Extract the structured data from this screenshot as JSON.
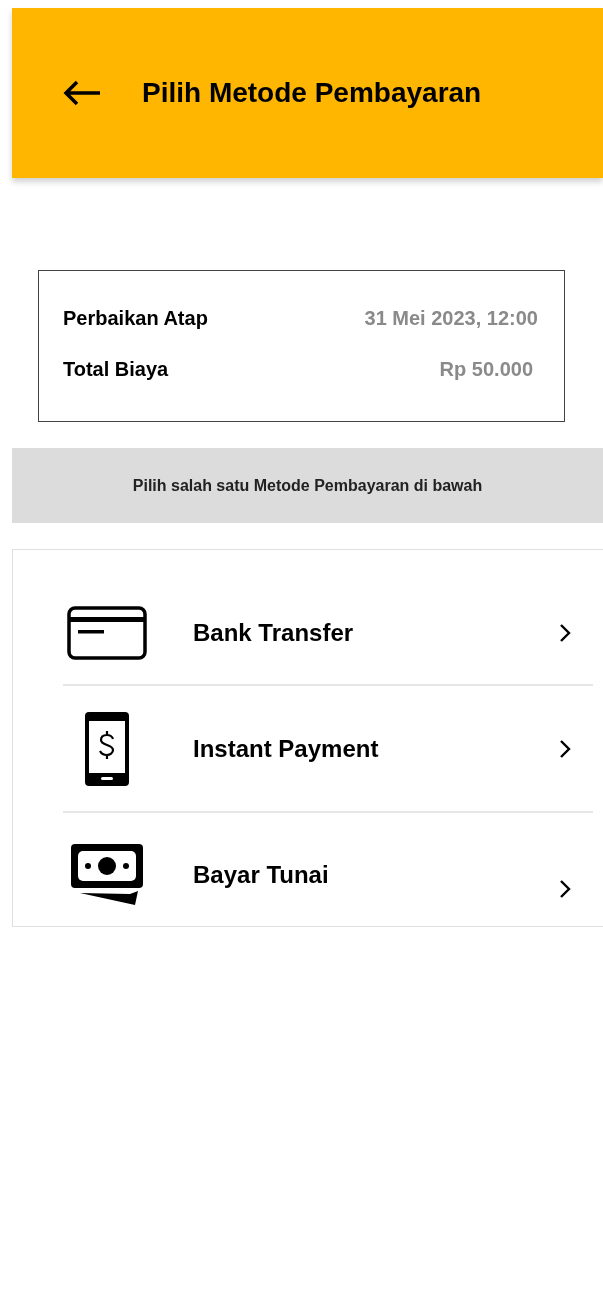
{
  "header": {
    "title": "Pilih Metode Pembayaran"
  },
  "order": {
    "service": "Perbaikan Atap",
    "datetime": "31 Mei 2023, 12:00",
    "total_label": "Total Biaya",
    "total": "Rp 50.000"
  },
  "instruction": "Pilih salah satu Metode Pembayaran di bawah",
  "methods": [
    {
      "kind": "card",
      "label": "Bank Transfer"
    },
    {
      "kind": "phone",
      "label": "Instant Payment"
    },
    {
      "kind": "cash",
      "label": "Bayar Tunai"
    }
  ]
}
